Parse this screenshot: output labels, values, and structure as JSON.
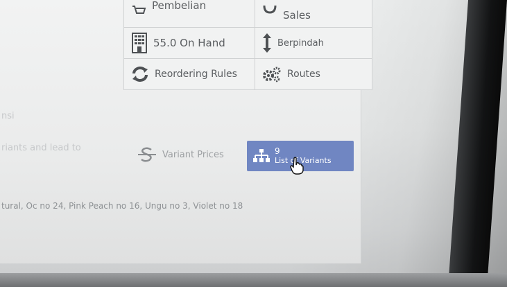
{
  "smart_buttons": [
    {
      "name": "purchase",
      "label": "Pembelian",
      "icon": "shopping-cart-icon"
    },
    {
      "name": "sales",
      "label": "Sales",
      "icon": "sales-icon"
    },
    {
      "name": "on-hand",
      "label": "55.0 On Hand",
      "icon": "building-icon"
    },
    {
      "name": "moves",
      "label": "Berpindah",
      "icon": "updown-arrow-icon"
    },
    {
      "name": "reordering",
      "label": "Reordering Rules",
      "icon": "refresh-icon"
    },
    {
      "name": "routes",
      "label": "Routes",
      "icon": "cogs-icon"
    }
  ],
  "left_form": {
    "label_partial": "nsi",
    "help_partial": "riants and lead to"
  },
  "variant_prices": {
    "label": "Variant Prices",
    "icon": "strikethrough-s-icon"
  },
  "variants_button": {
    "count": "9",
    "label": "List of Variants",
    "icon": "sitemap-icon"
  },
  "attribute_values_line": "tural, Oc no 24, Pink Peach no 16, Ungu no 3, Violet no 18",
  "colors": {
    "accent": "#7086c2",
    "text": "#5b5e61",
    "muted": "#9da0a3"
  }
}
